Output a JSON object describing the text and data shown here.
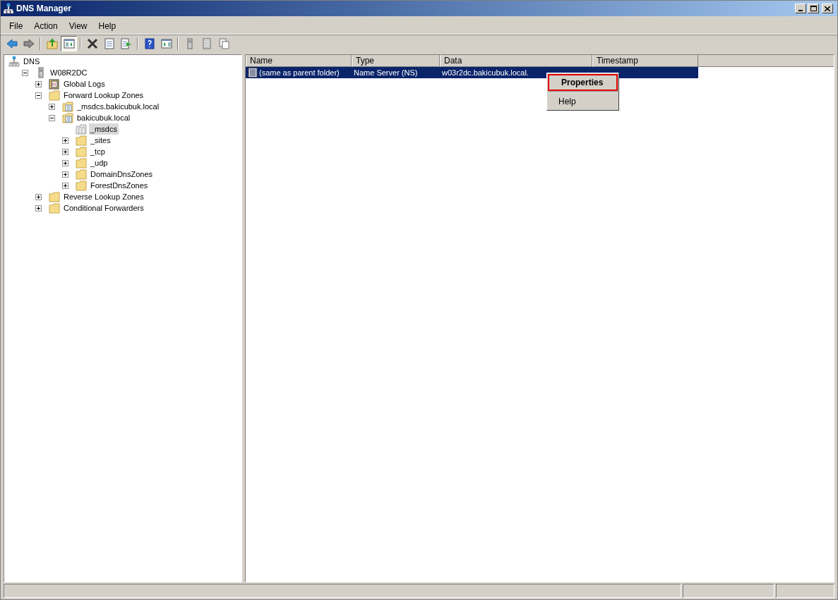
{
  "window": {
    "title": "DNS Manager"
  },
  "menu_bar": [
    "File",
    "Action",
    "View",
    "Help"
  ],
  "toolbar": [
    {
      "kind": "back",
      "pressed": false
    },
    {
      "kind": "forward",
      "pressed": false
    },
    {
      "kind": "sep"
    },
    {
      "kind": "up",
      "pressed": false
    },
    {
      "kind": "tree",
      "pressed": true
    },
    {
      "kind": "sep"
    },
    {
      "kind": "delete",
      "pressed": false
    },
    {
      "kind": "properties",
      "pressed": false
    },
    {
      "kind": "export",
      "pressed": false
    },
    {
      "kind": "sep"
    },
    {
      "kind": "help",
      "pressed": false
    },
    {
      "kind": "pane",
      "pressed": false
    },
    {
      "kind": "sep"
    },
    {
      "kind": "server",
      "pressed": false
    },
    {
      "kind": "list",
      "pressed": false
    },
    {
      "kind": "copy",
      "pressed": false
    }
  ],
  "tree": [
    {
      "label": "DNS",
      "kind": "dns",
      "expandable": false,
      "expanded": true,
      "selected": false,
      "children": [
        {
          "label": "W08R2DC",
          "kind": "server",
          "expandable": true,
          "expanded": true,
          "selected": false,
          "children": [
            {
              "label": "Global Logs",
              "kind": "logs",
              "expandable": true,
              "expanded": false,
              "selected": false
            },
            {
              "label": "Forward Lookup Zones",
              "kind": "folder",
              "expandable": true,
              "expanded": true,
              "selected": false,
              "children": [
                {
                  "label": "_msdcs.bakicubuk.local",
                  "kind": "zone",
                  "expandable": true,
                  "expanded": false,
                  "selected": false
                },
                {
                  "label": "bakicubuk.local",
                  "kind": "zone",
                  "expandable": true,
                  "expanded": true,
                  "selected": false,
                  "children": [
                    {
                      "label": "_msdcs",
                      "kind": "delegated",
                      "expandable": false,
                      "selected": true
                    },
                    {
                      "label": "_sites",
                      "kind": "folder",
                      "expandable": true,
                      "expanded": false,
                      "selected": false
                    },
                    {
                      "label": "_tcp",
                      "kind": "folder",
                      "expandable": true,
                      "expanded": false,
                      "selected": false
                    },
                    {
                      "label": "_udp",
                      "kind": "folder",
                      "expandable": true,
                      "expanded": false,
                      "selected": false
                    },
                    {
                      "label": "DomainDnsZones",
                      "kind": "folder",
                      "expandable": true,
                      "expanded": false,
                      "selected": false
                    },
                    {
                      "label": "ForestDnsZones",
                      "kind": "folder",
                      "expandable": true,
                      "expanded": false,
                      "selected": false
                    }
                  ]
                }
              ]
            },
            {
              "label": "Reverse Lookup Zones",
              "kind": "folder",
              "expandable": true,
              "expanded": false,
              "selected": false
            },
            {
              "label": "Conditional Forwarders",
              "kind": "folder",
              "expandable": true,
              "expanded": false,
              "selected": false
            }
          ]
        }
      ]
    }
  ],
  "table": {
    "columns": [
      "Name",
      "Type",
      "Data",
      "Timestamp"
    ],
    "rows": [
      {
        "cells": [
          "(same as parent folder)",
          "Name Server (NS)",
          "w03r2dc.bakicubuk.local."
        ],
        "selected": true
      }
    ]
  },
  "context_menu": [
    {
      "label": "Properties",
      "selected": true
    },
    {
      "label": "Help",
      "selected": false
    }
  ]
}
